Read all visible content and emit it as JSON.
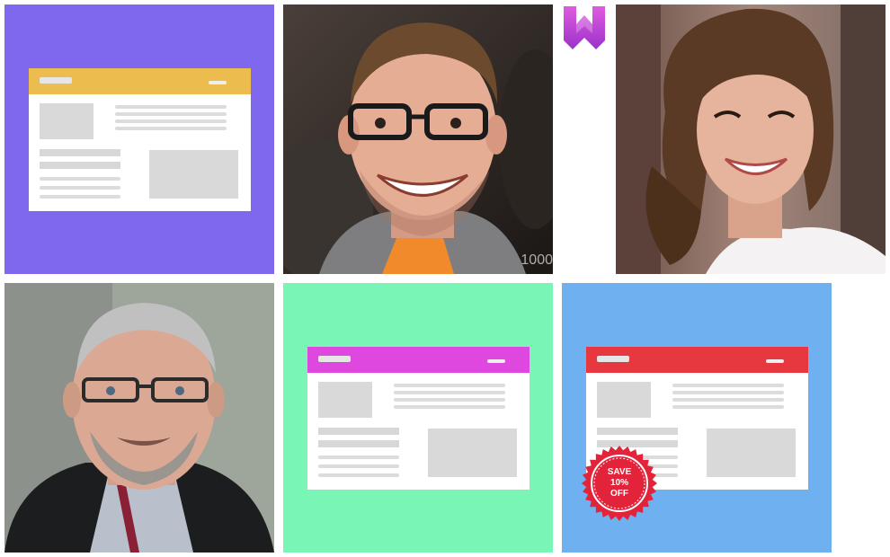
{
  "gallery": {
    "tiles": [
      {
        "kind": "template",
        "bg": "#7f67ee",
        "header": "#ecbd4e"
      },
      {
        "kind": "photo",
        "subject": "smiling-man-glasses",
        "watermark": "1000"
      },
      {
        "kind": "photo",
        "subject": "smiling-woman-curly-hair"
      },
      {
        "kind": "photo",
        "subject": "older-man-glasses-beard"
      },
      {
        "kind": "template",
        "bg": "#79f6b5",
        "header": "#de48de"
      },
      {
        "kind": "template",
        "bg": "#6fb0f0",
        "header": "#e7373f"
      }
    ]
  },
  "logo": {
    "icon": "w-logo-icon",
    "color": "#b23fd3"
  },
  "badge": {
    "line1": "SAVE",
    "line2": "10%",
    "line3": "OFF",
    "color": "#e3233a"
  }
}
